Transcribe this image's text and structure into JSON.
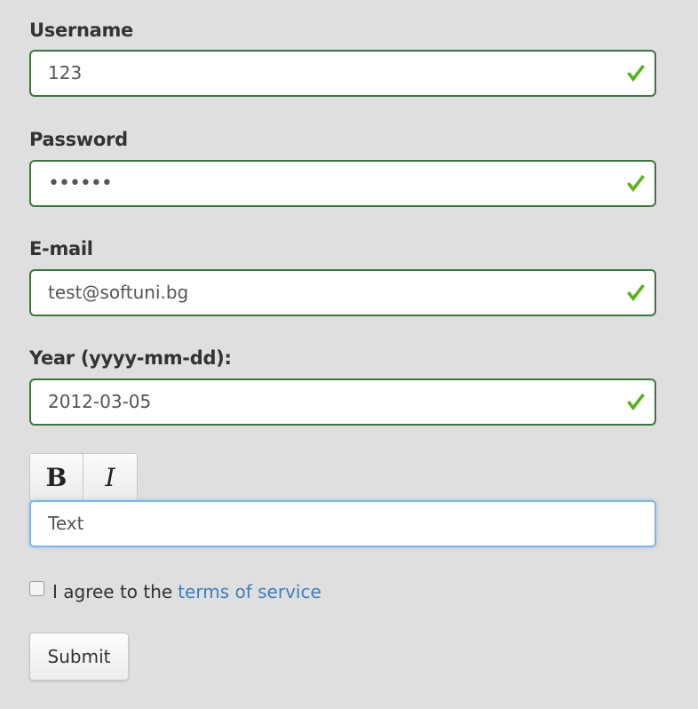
{
  "form": {
    "fields": [
      {
        "label": "Username",
        "value": "123",
        "valid": true
      },
      {
        "label": "Password",
        "value": "••••••",
        "valid": true
      },
      {
        "label": "E-mail",
        "value": "test@softuni.bg",
        "valid": true
      },
      {
        "label": "Year (yyyy-mm-dd):",
        "value": "2012-03-05",
        "valid": true
      }
    ],
    "editor": {
      "bold_label": "B",
      "italic_label": "I",
      "value": "Text"
    },
    "agree": {
      "checked": false,
      "text": "I agree to the",
      "link_text": "terms of service"
    },
    "submit_label": "Submit"
  },
  "colors": {
    "background": "#e0dfe0",
    "valid_border": "#3c763d",
    "check_icon": "#5cb21e",
    "focus_border": "#7eb5e6",
    "link": "#3f7fbf"
  },
  "icons": {
    "valid": "check-icon"
  }
}
